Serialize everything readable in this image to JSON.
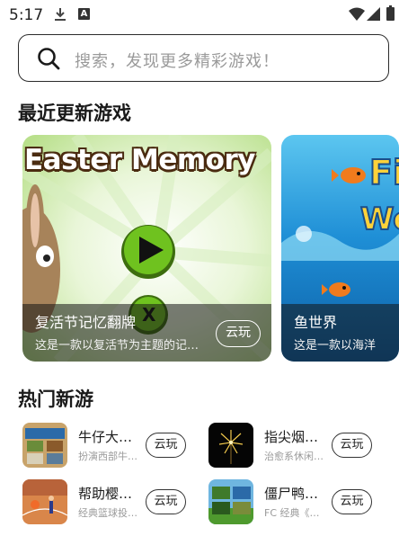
{
  "status_bar": {
    "time": "5:17",
    "icons": [
      "download-icon",
      "a-notification-icon",
      "wifi-icon",
      "signal-icon",
      "battery-icon"
    ],
    "notification_letter": "A"
  },
  "search": {
    "placeholder": "搜索，发现更多精彩游戏！"
  },
  "recent": {
    "title": "最近更新游戏",
    "cards": [
      {
        "name": "复活节记忆翻牌",
        "description": "这是一款以复活节为主题的记忆翻牌游戏",
        "art_title": "Easter Memory",
        "button": "云玩"
      },
      {
        "name": "鱼世界",
        "description": "这是一款以海洋",
        "art_title": "Fi Wo",
        "button": "云玩"
      }
    ]
  },
  "hot": {
    "title": "热门新游",
    "games": [
      {
        "name": "牛仔大…",
        "description": "扮演西部牛…",
        "button": "云玩"
      },
      {
        "name": "指尖烟…",
        "description": "治愈系休闲…",
        "button": "云玩"
      },
      {
        "name": "帮助樱…",
        "description": "经典篮球投…",
        "button": "云玩"
      },
      {
        "name": "僵尸鸭…",
        "description": "FC 经典《…",
        "button": "云玩"
      }
    ]
  },
  "colors": {
    "accent_dark": "#1a1a1a",
    "placeholder_gray": "#9a9a9a",
    "play_green": "#6fc21f",
    "ocean_blue": "#1f8fd6"
  }
}
